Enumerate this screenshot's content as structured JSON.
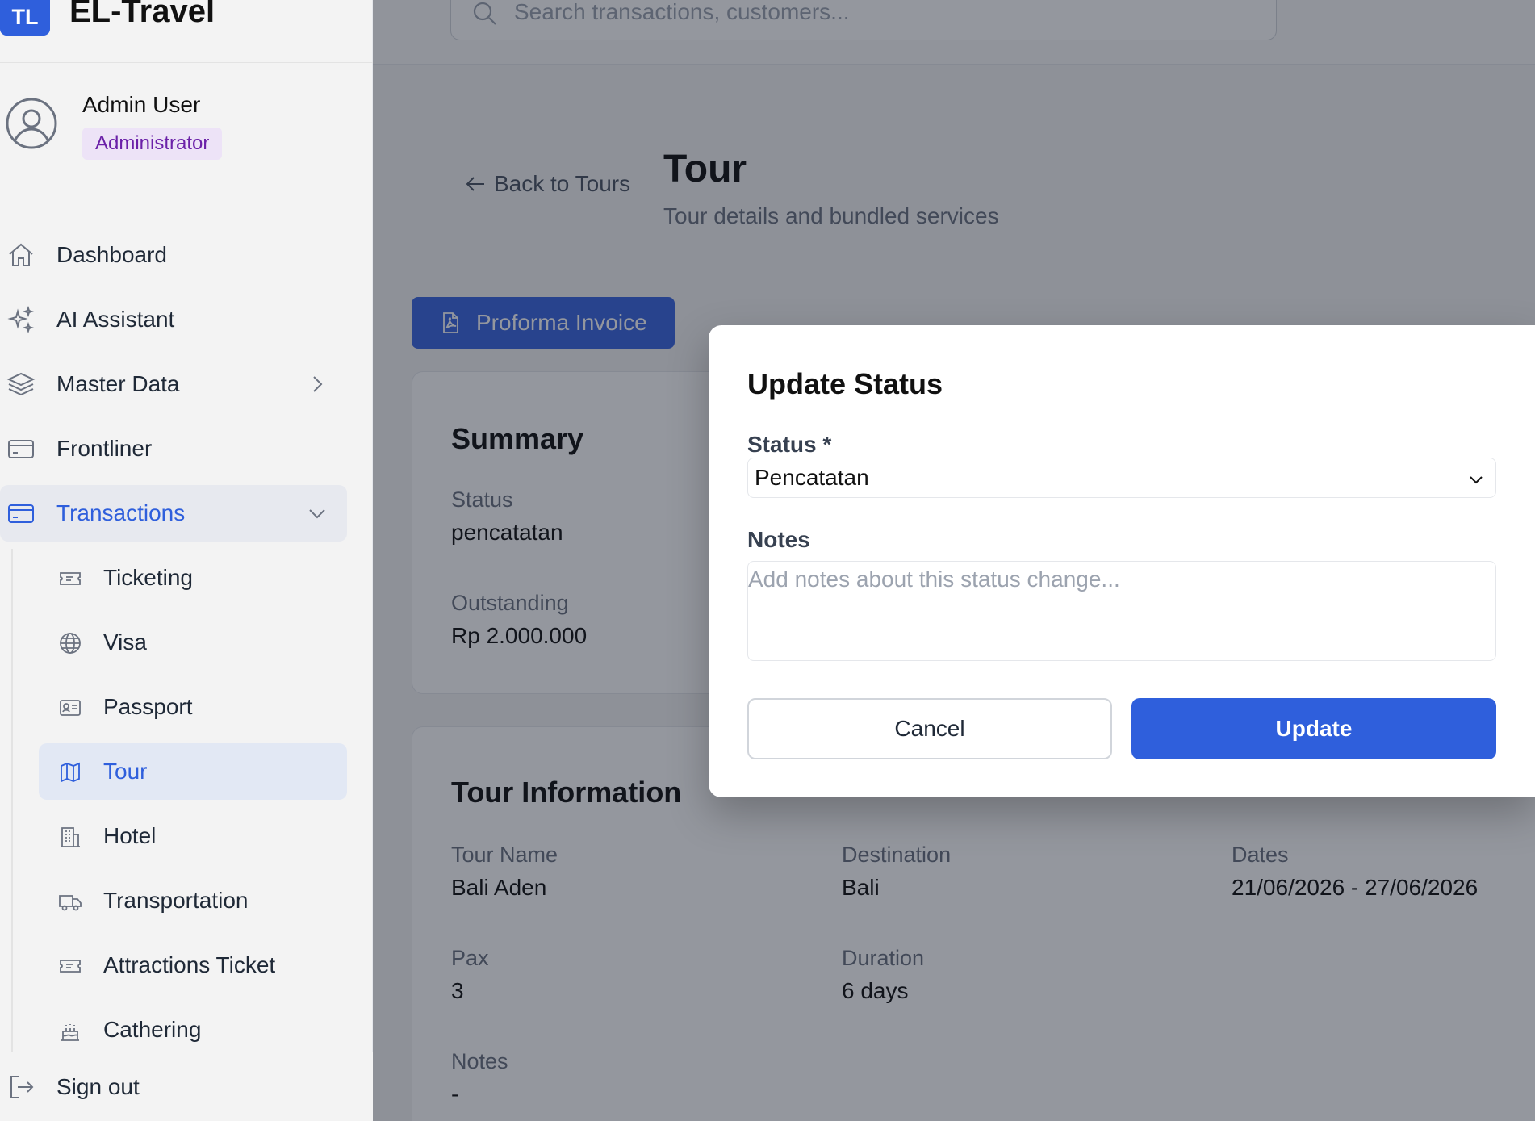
{
  "brand": {
    "logo": "TL",
    "name": "EL-Travel"
  },
  "user": {
    "name": "Admin User",
    "role": "Administrator"
  },
  "nav": {
    "dashboard": "Dashboard",
    "ai": "AI Assistant",
    "master": "Master Data",
    "frontliner": "Frontliner",
    "transactions": "Transactions",
    "sub": {
      "ticketing": "Ticketing",
      "visa": "Visa",
      "passport": "Passport",
      "tour": "Tour",
      "hotel": "Hotel",
      "transportation": "Transportation",
      "attractions": "Attractions Ticket",
      "cathering": "Cathering"
    },
    "signout": "Sign out"
  },
  "search": {
    "placeholder": "Search transactions, customers..."
  },
  "page": {
    "back": "Back to Tours",
    "title": "Tour",
    "subtitle": "Tour details and bundled services",
    "pdf_button": "Proforma Invoice"
  },
  "summary": {
    "title": "Summary",
    "status_label": "Status",
    "status_value": "pencatatan",
    "outstanding_label": "Outstanding",
    "outstanding_value": "Rp 2.000.000"
  },
  "tour_info": {
    "title": "Tour Information",
    "name_label": "Tour Name",
    "name_value": "Bali Aden",
    "dest_label": "Destination",
    "dest_value": "Bali",
    "dates_label": "Dates",
    "dates_value": "21/06/2026 - 27/06/2026",
    "pax_label": "Pax",
    "pax_value": "3",
    "duration_label": "Duration",
    "duration_value": "6 days",
    "notes_label": "Notes",
    "notes_value": "-"
  },
  "modal": {
    "title": "Update Status",
    "status_label": "Status *",
    "status_value": "Pencatatan",
    "notes_label": "Notes",
    "notes_placeholder": "Add notes about this status change...",
    "cancel": "Cancel",
    "update": "Update"
  },
  "colors": {
    "primary": "#2f5fdc",
    "overlay": "rgba(17,24,39,0.45)",
    "role_badge_bg": "#ede3f7",
    "role_badge_text": "#6b21a8"
  }
}
